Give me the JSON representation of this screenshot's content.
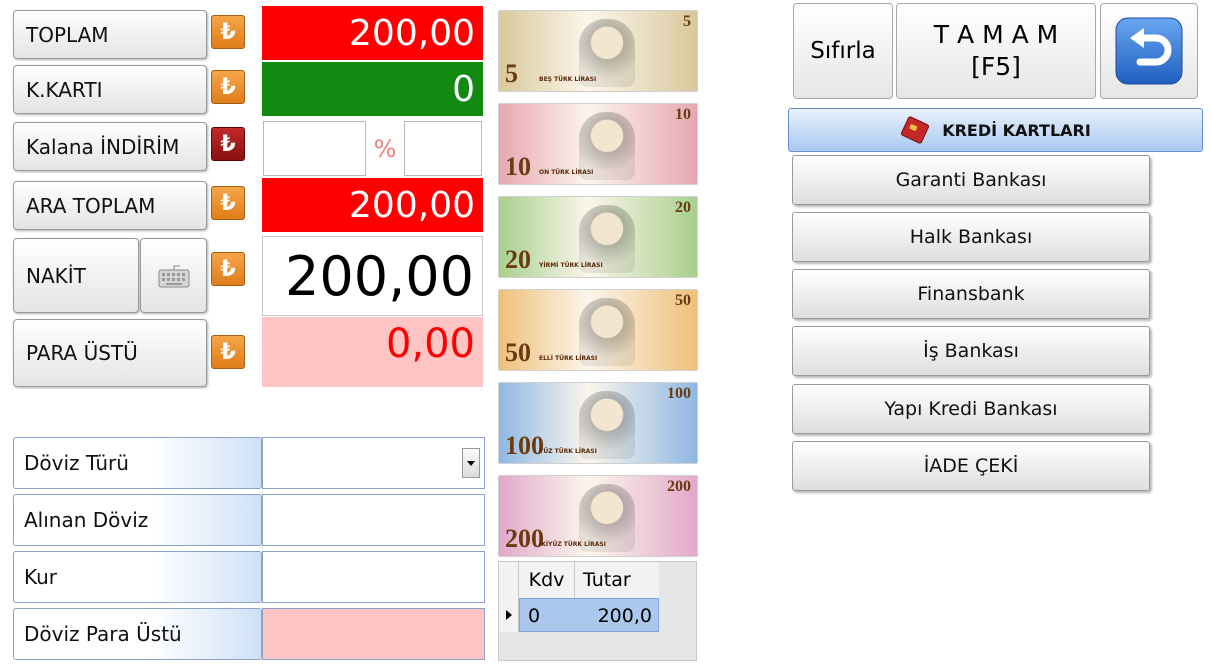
{
  "rows": {
    "toplam": {
      "label": "TOPLAM",
      "value": "200,00"
    },
    "kkarti": {
      "label": "K.KARTI",
      "value": "0"
    },
    "indirim": {
      "label": "Kalana İNDİRİM",
      "percent_sign": "%"
    },
    "ara_toplam": {
      "label": "ARA TOPLAM",
      "value": "200,00"
    },
    "nakit": {
      "label": "NAKİT",
      "value": "200,00"
    },
    "para_ustu": {
      "label": "PARA ÜSTÜ",
      "value": "0,00"
    }
  },
  "currency_symbol": "₺",
  "doviz": {
    "turu": {
      "label": "Döviz Türü",
      "value": ""
    },
    "alinan": {
      "label": "Alınan Döviz",
      "value": ""
    },
    "kur": {
      "label": "Kur",
      "value": ""
    },
    "para_ustu": {
      "label": "Döviz Para Üstü",
      "value": ""
    }
  },
  "banknotes": [
    {
      "value": "5",
      "word": "BEŞ TÜRK LİRASI",
      "color": "#d9c89a"
    },
    {
      "value": "10",
      "word": "ON TÜRK LİRASI",
      "color": "#e7a6b0"
    },
    {
      "value": "20",
      "word": "YİRMİ TÜRK LİRASI",
      "color": "#a8cf8c"
    },
    {
      "value": "50",
      "word": "ELLİ TÜRK LİRASI",
      "color": "#efc07a"
    },
    {
      "value": "100",
      "word": "YÜZ TÜRK LİRASI",
      "color": "#8fb8e4"
    },
    {
      "value": "200",
      "word": "İKİYÜZ TÜRK LİRASI",
      "color": "#e2a8c9"
    }
  ],
  "kdv_grid": {
    "headers": [
      "Kdv",
      "Tutar"
    ],
    "rows": [
      {
        "kdv": "0",
        "tutar": "200,0"
      }
    ]
  },
  "actions": {
    "reset": "Sıfırla",
    "ok_line1": "T A M A M",
    "ok_line2": "[F5]"
  },
  "cards": {
    "header": "KREDİ KARTLARI",
    "banks": [
      "Garanti Bankası",
      "Halk Bankası",
      "Finansbank",
      "İş Bankası",
      "Yapı Kredi Bankası",
      "İADE ÇEKİ"
    ]
  },
  "colors": {
    "red": "#ff0000",
    "green": "#108a10",
    "pink": "#ffc4c4",
    "orange": "#e88a25",
    "accent_blue": "#2f6fd0"
  }
}
